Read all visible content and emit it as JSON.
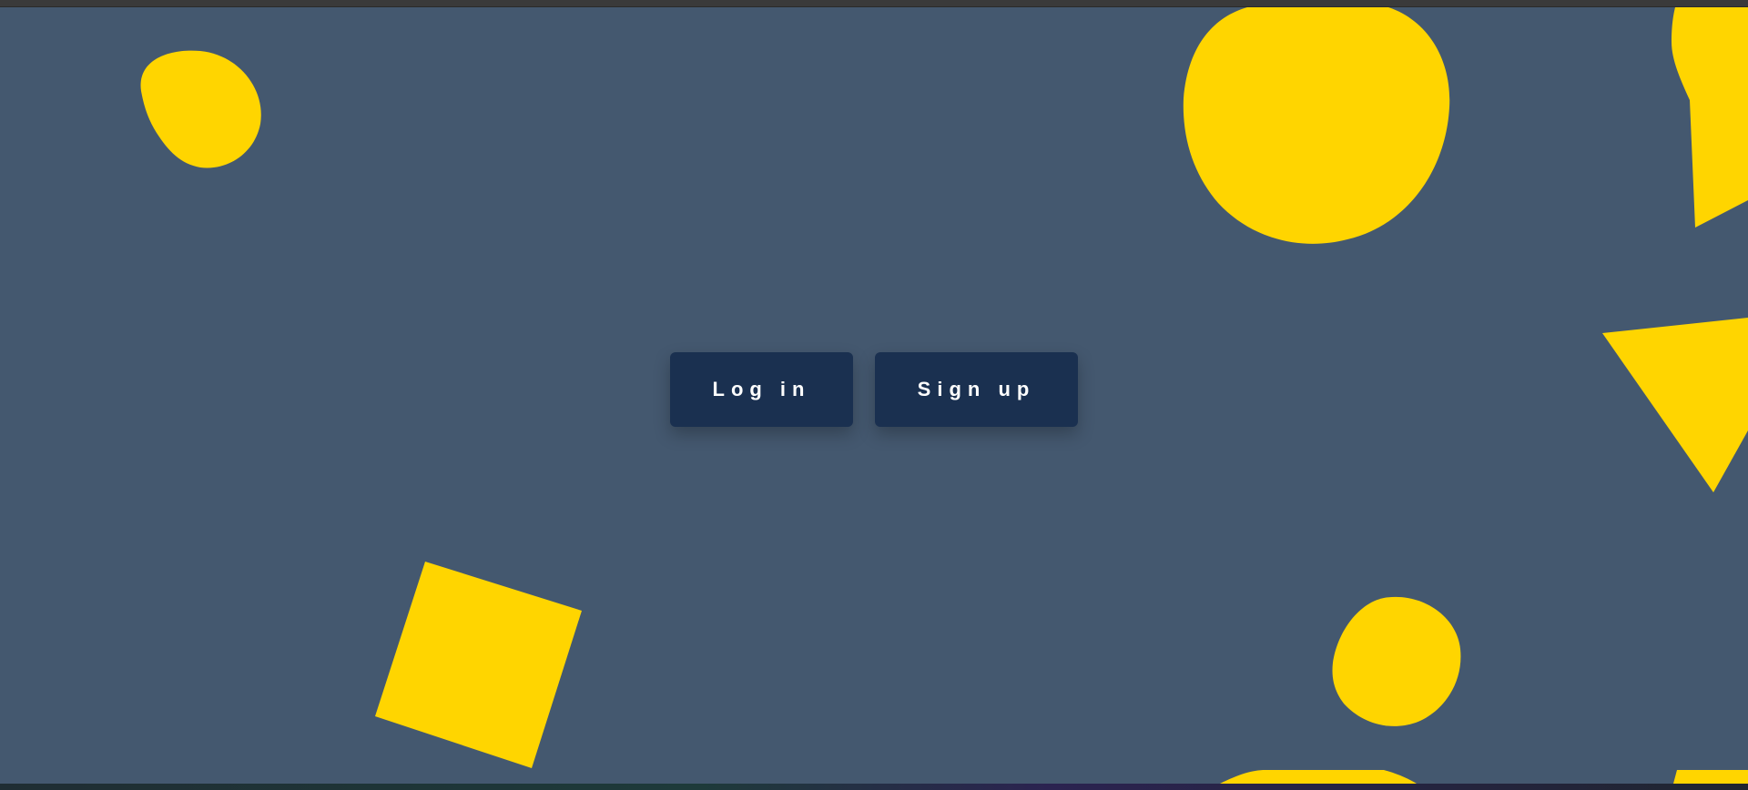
{
  "actions": {
    "login_label": "Log in",
    "signup_label": "Sign up"
  },
  "colors": {
    "background": "#44586f",
    "shape_fill": "#ffd500",
    "button_bg": "#1a3050",
    "button_text": "#ffffff"
  },
  "decorations": [
    "blob",
    "blob",
    "blob",
    "square",
    "triangle",
    "triangle",
    "blob",
    "blob"
  ]
}
